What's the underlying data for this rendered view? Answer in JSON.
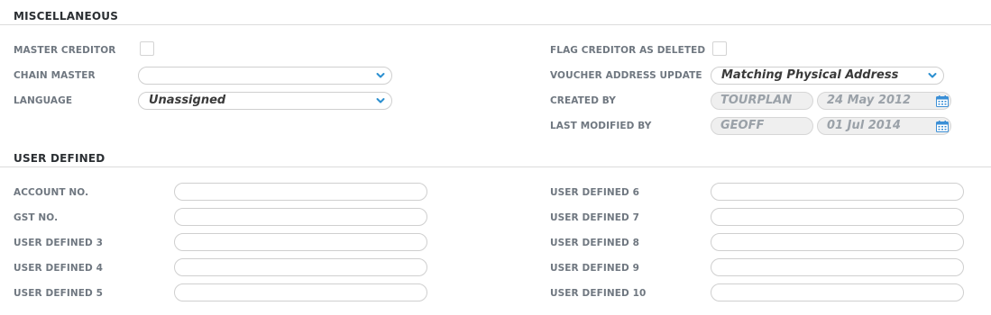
{
  "miscellaneous": {
    "title": "MISCELLANEOUS",
    "master_creditor": {
      "label": "MASTER CREDITOR",
      "checked": false
    },
    "flag_deleted": {
      "label": "FLAG CREDITOR AS DELETED",
      "checked": false
    },
    "chain_master": {
      "label": "CHAIN MASTER",
      "value": ""
    },
    "voucher_address_update": {
      "label": "VOUCHER ADDRESS UPDATE",
      "value": "Matching Physical Address"
    },
    "language": {
      "label": "LANGUAGE",
      "value": "Unassigned"
    },
    "created_by": {
      "label": "CREATED BY",
      "user": "TOURPLAN",
      "date": "24 May 2012"
    },
    "last_modified_by": {
      "label": "LAST MODIFIED BY",
      "user": "GEOFF",
      "date": "01 Jul 2014"
    }
  },
  "user_defined": {
    "title": "USER DEFINED",
    "left": [
      {
        "label": "ACCOUNT NO.",
        "value": ""
      },
      {
        "label": "GST NO.",
        "value": ""
      },
      {
        "label": "USER DEFINED 3",
        "value": ""
      },
      {
        "label": "USER DEFINED 4",
        "value": ""
      },
      {
        "label": "USER DEFINED 5",
        "value": ""
      }
    ],
    "right": [
      {
        "label": "USER DEFINED 6",
        "value": ""
      },
      {
        "label": "USER DEFINED 7",
        "value": ""
      },
      {
        "label": "USER DEFINED 8",
        "value": ""
      },
      {
        "label": "USER DEFINED 9",
        "value": ""
      },
      {
        "label": "USER DEFINED 10",
        "value": ""
      }
    ]
  },
  "icons": {
    "dropdown": "chevron-down-icon",
    "calendar": "calendar-icon"
  },
  "colors": {
    "chevron": "#2a8fd0",
    "calendar": "#3b8fd6",
    "label": "#6f7780"
  }
}
